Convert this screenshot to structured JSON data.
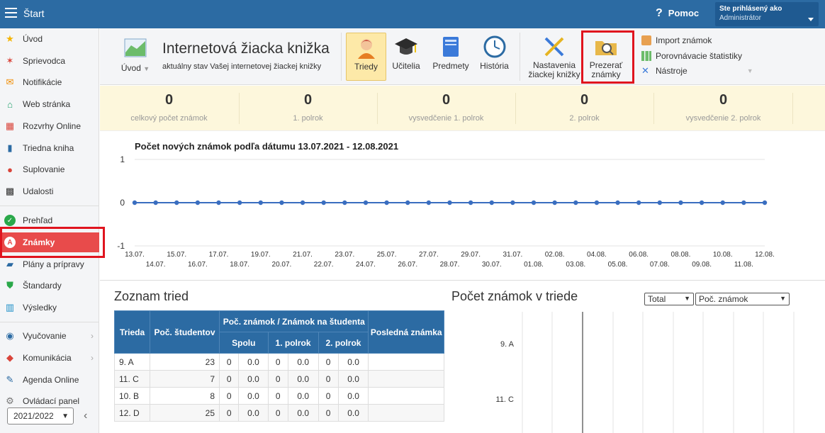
{
  "app": {
    "title": "Štart"
  },
  "header": {
    "help_label": "Pomoc",
    "user_line1": "Ste prihlásený ako",
    "user_line2": "Administrátor"
  },
  "sidebar": {
    "items": [
      {
        "label": "Úvod",
        "icon": "star-icon"
      },
      {
        "label": "Sprievodca",
        "icon": "wand-icon"
      },
      {
        "label": "Notifikácie",
        "icon": "envelope-icon"
      },
      {
        "label": "Web stránka",
        "icon": "house-icon"
      },
      {
        "label": "Rozvrhy Online",
        "icon": "calendar-icon"
      },
      {
        "label": "Triedna kniha",
        "icon": "book-icon"
      },
      {
        "label": "Suplovanie",
        "icon": "user-icon"
      },
      {
        "label": "Udalosti",
        "icon": "calendar-grid-icon"
      },
      {
        "label": "Prehľad",
        "icon": "check-icon"
      },
      {
        "label": "Známky",
        "icon": "grade-icon"
      },
      {
        "label": "Plány a prípravy",
        "icon": "briefcase-icon"
      },
      {
        "label": "Štandardy",
        "icon": "shield-check-icon"
      },
      {
        "label": "Výsledky",
        "icon": "bar-chart-icon"
      },
      {
        "label": "Vyučovanie",
        "icon": "globe-icon"
      },
      {
        "label": "Komunikácia",
        "icon": "chat-icon"
      },
      {
        "label": "Agenda Online",
        "icon": "pen-icon"
      },
      {
        "label": "Ovládací panel",
        "icon": "gear-icon"
      }
    ],
    "school_year": "2021/2022"
  },
  "ribbon": {
    "uvod_label": "Úvod",
    "title": "Internetová žiacka knižka",
    "subtitle": "aktuálny stav Vašej internetovej žiackej knižky",
    "buttons": {
      "triedy": "Triedy",
      "ucitelia": "Učitelia",
      "predmety": "Predmety",
      "historia": "História",
      "nastavenia_1": "Nastavenia",
      "nastavenia_2": "žiackej knižky",
      "prezerat_1": "Prezerať",
      "prezerat_2": "známky"
    },
    "small": {
      "import": "Import známok",
      "porovnavacie": "Porovnávacie štatistiky",
      "nastroje": "Nástroje"
    }
  },
  "stats": [
    {
      "value": "0",
      "label": "celkový počet známok"
    },
    {
      "value": "0",
      "label": "1. polrok"
    },
    {
      "value": "0",
      "label": "vysvedčenie 1. polrok"
    },
    {
      "value": "0",
      "label": "2. polrok"
    },
    {
      "value": "0",
      "label": "vysvedčenie 2. polrok"
    }
  ],
  "chart_data": {
    "type": "line",
    "title": "Počet nových známok podľa dátumu 13.07.2021 - 12.08.2021",
    "ylim": [
      -1,
      1
    ],
    "yticks": [
      "1",
      "0",
      "-1"
    ],
    "x": [
      "13.07.",
      "14.07.",
      "15.07.",
      "16.07.",
      "17.07.",
      "18.07.",
      "19.07.",
      "20.07.",
      "21.07.",
      "22.07.",
      "23.07.",
      "24.07.",
      "25.07.",
      "26.07.",
      "27.07.",
      "28.07.",
      "29.07.",
      "30.07.",
      "31.07.",
      "01.08.",
      "02.08.",
      "03.08.",
      "04.08.",
      "05.08.",
      "06.08.",
      "07.08.",
      "08.08.",
      "09.08.",
      "10.08.",
      "11.08.",
      "12.08."
    ],
    "series": [
      {
        "values": [
          0,
          0,
          0,
          0,
          0,
          0,
          0,
          0,
          0,
          0,
          0,
          0,
          0,
          0,
          0,
          0,
          0,
          0,
          0,
          0,
          0,
          0,
          0,
          0,
          0,
          0,
          0,
          0,
          0,
          0,
          0
        ],
        "color": "#3a6ec0"
      }
    ]
  },
  "classes": {
    "title": "Zoznam tried",
    "headers": {
      "trieda": "Trieda",
      "pocet": "Poč. študentov",
      "group": "Poč. známok / Známok na študenta",
      "spolu": "Spolu",
      "p1": "1. polrok",
      "p2": "2. polrok",
      "posledna": "Posledná známka"
    },
    "rows": [
      {
        "trieda": "9. A",
        "pocet": "23",
        "s1": "0",
        "s2": "0.0",
        "a1": "0",
        "a2": "0.0",
        "b1": "0",
        "b2": "0.0",
        "posledna": ""
      },
      {
        "trieda": "11. C",
        "pocet": "7",
        "s1": "0",
        "s2": "0.0",
        "a1": "0",
        "a2": "0.0",
        "b1": "0",
        "b2": "0.0",
        "posledna": ""
      },
      {
        "trieda": "10. B",
        "pocet": "8",
        "s1": "0",
        "s2": "0.0",
        "a1": "0",
        "a2": "0.0",
        "b1": "0",
        "b2": "0.0",
        "posledna": ""
      },
      {
        "trieda": "12. D",
        "pocet": "25",
        "s1": "0",
        "s2": "0.0",
        "a1": "0",
        "a2": "0.0",
        "b1": "0",
        "b2": "0.0",
        "posledna": ""
      }
    ]
  },
  "grades_panel": {
    "title": "Počet známok v triede",
    "select1": "Total",
    "select2": "Poč. známok",
    "categories": [
      "9. A",
      "11. C"
    ]
  },
  "colors": {
    "primary": "#2c6ba3",
    "active": "#e84b4b",
    "highlight": "#e0141e",
    "stats_bg": "#fdf7dc"
  }
}
